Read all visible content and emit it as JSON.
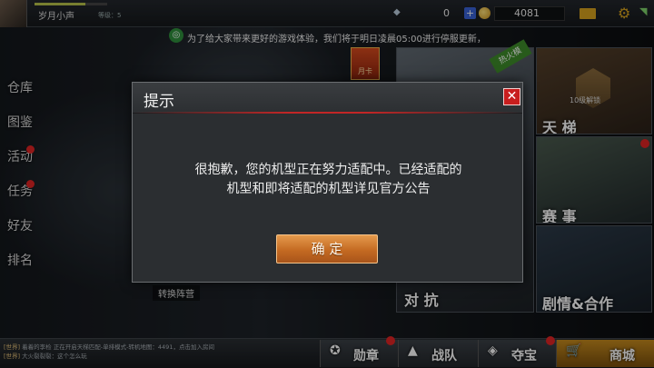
{
  "header": {
    "player_name": "岁月小声",
    "player_level": "等级：5",
    "level_progress": 0.7,
    "gem_count": "0",
    "coin_count": "4081",
    "plus_label": "+"
  },
  "notice": {
    "text": "为了给大家带来更好的游戏体验，我们将于明日凌晨05:00进行停服更新，"
  },
  "side_nav": {
    "items": [
      "仓库",
      "图鉴",
      "活动",
      "任务",
      "好友",
      "排名"
    ]
  },
  "tiles": {
    "ladder_label": "天 梯",
    "ladder_sub": "10级解锁",
    "event_label": "赛 事",
    "story_label": "剧情&合作",
    "battle_label": "对 抗",
    "hot_ribbon": "热火模",
    "monthly_badge": "月卡",
    "exchange_label": "转换阵营"
  },
  "chat": {
    "line1_tag": "[世界]",
    "line1": "着着的李检  正在开启天梯匹配-单排模式-转机地图：4491，点击加入房间",
    "line2_tag": "[世界]",
    "line2": "大火裂裂裂：这个怎么玩"
  },
  "bottom": {
    "medal": "勋章",
    "team": "战队",
    "treasure": "夺宝",
    "shop": "商城"
  },
  "dialog": {
    "title": "提示",
    "close": "✕",
    "message_line1": "很抱歉，您的机型正在努力适配中。已经适配的",
    "message_line2": "机型和即将适配的机型详见官方公告",
    "confirm": "确 定"
  },
  "colors": {
    "accent_red": "#c81e1e",
    "confirm_orange": "#c46a22",
    "gold": "#d6a21e"
  }
}
